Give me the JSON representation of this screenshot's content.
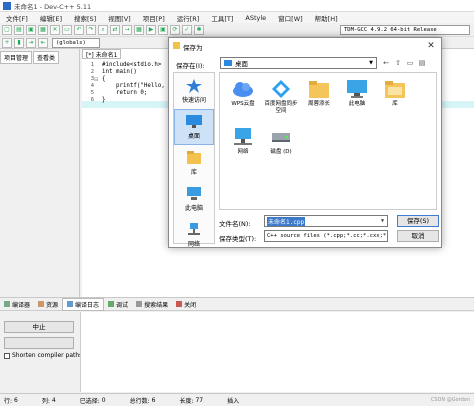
{
  "window": {
    "title": "未命名1 - Dev-C++ 5.11",
    "menu": [
      "文件[F]",
      "编辑[E]",
      "搜索[S]",
      "视图[V]",
      "项目[P]",
      "运行[R]",
      "工具[T]",
      "AStyle",
      "窗口[W]",
      "帮助[H]"
    ],
    "compiler_combo": "TDM-GCC 4.9.2 64-bit Release",
    "globals_combo": "(globals)",
    "left_tabs": [
      "项目管理",
      "查看类"
    ],
    "editor_tab": "[*] 未命名1",
    "code": [
      {
        "n": "1",
        "text": "#include<stdio.h>"
      },
      {
        "n": "2",
        "text": "int main()"
      },
      {
        "n": "3",
        "text": "{"
      },
      {
        "n": "4",
        "text": "    printf(\"Hello,"
      },
      {
        "n": "5",
        "text": "    return 0;"
      },
      {
        "n": "6",
        "text": "}"
      }
    ]
  },
  "bottom": {
    "tabs": [
      "编译器",
      "资源",
      "编译日志",
      "调试",
      "搜索结果",
      "关闭"
    ],
    "abort_button": "中止",
    "shorten_checkbox": "Shorten compiler paths"
  },
  "status": {
    "row_label": "行:",
    "row": "6",
    "col_label": "列:",
    "col": "4",
    "sel_label": "已选择:",
    "sel": "0",
    "lines_label": "总行数:",
    "lines": "6",
    "len_label": "长度:",
    "len": "77",
    "mode": "插入",
    "watermark": "CSDN @Gordon"
  },
  "dialog": {
    "title": "保存为",
    "lookin_label": "保存在(I):",
    "lookin_value": "桌面",
    "places": [
      {
        "label": "快速访问",
        "icon": "star-icon",
        "selected": false
      },
      {
        "label": "桌面",
        "icon": "desktop-icon",
        "selected": true
      },
      {
        "label": "库",
        "icon": "library-icon",
        "selected": false
      },
      {
        "label": "此电脑",
        "icon": "computer-icon",
        "selected": false
      },
      {
        "label": "网络",
        "icon": "network-icon",
        "selected": false
      }
    ],
    "files": [
      {
        "label": "WPS云盘",
        "icon": "cloud-icon"
      },
      {
        "label": "百度网盘同步空间",
        "icon": "baidu-icon"
      },
      {
        "label": "周蓉添长",
        "icon": "folder-icon"
      },
      {
        "label": "此电脑",
        "icon": "computer-icon"
      },
      {
        "label": "库",
        "icon": "library-icon"
      },
      {
        "label": "网络",
        "icon": "network-icon"
      },
      {
        "label": "磁盘 (D)",
        "icon": "drive-icon"
      }
    ],
    "filename_label": "文件名(N):",
    "filename_value": "未命名1.cpp",
    "filetype_label": "保存类型(T):",
    "filetype_value": "C++ source files (*.cpp;*.cc;*.cxx;*.c++;*.hp",
    "save_button": "保存(S)",
    "cancel_button": "取消"
  }
}
